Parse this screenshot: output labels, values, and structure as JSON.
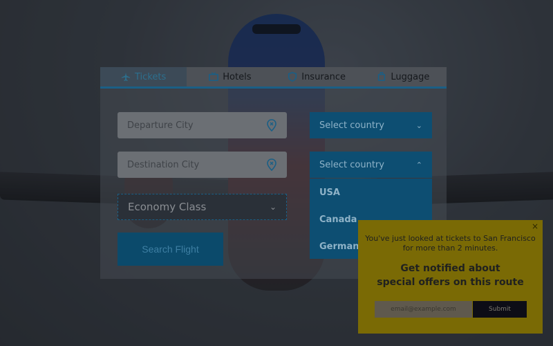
{
  "tabs": [
    {
      "label": "Tickets",
      "icon": "plane-icon"
    },
    {
      "label": "Hotels",
      "icon": "tv-icon"
    },
    {
      "label": "Insurance",
      "icon": "shield-icon"
    },
    {
      "label": "Luggage",
      "icon": "luggage-icon"
    }
  ],
  "form": {
    "departure_placeholder": "Departure City",
    "destination_placeholder": "Destination City",
    "departure_country_label": "Select country",
    "destination_country_label": "Select country",
    "class_value": "Economy Class",
    "search_label": "Search Flight",
    "country_options": [
      "USA",
      "Canada",
      "Germany"
    ]
  },
  "popup": {
    "close": "×",
    "message_line1": "You've just looked at tickets to San Francisco",
    "message_line2": "for more than 2 minutes.",
    "headline_line1": "Get notified about",
    "headline_line2": "special offers on this route",
    "email_placeholder": "email@example.com",
    "submit_label": "Submit"
  },
  "colors": {
    "accent": "#0d4e72",
    "popup": "#7a6a05"
  }
}
